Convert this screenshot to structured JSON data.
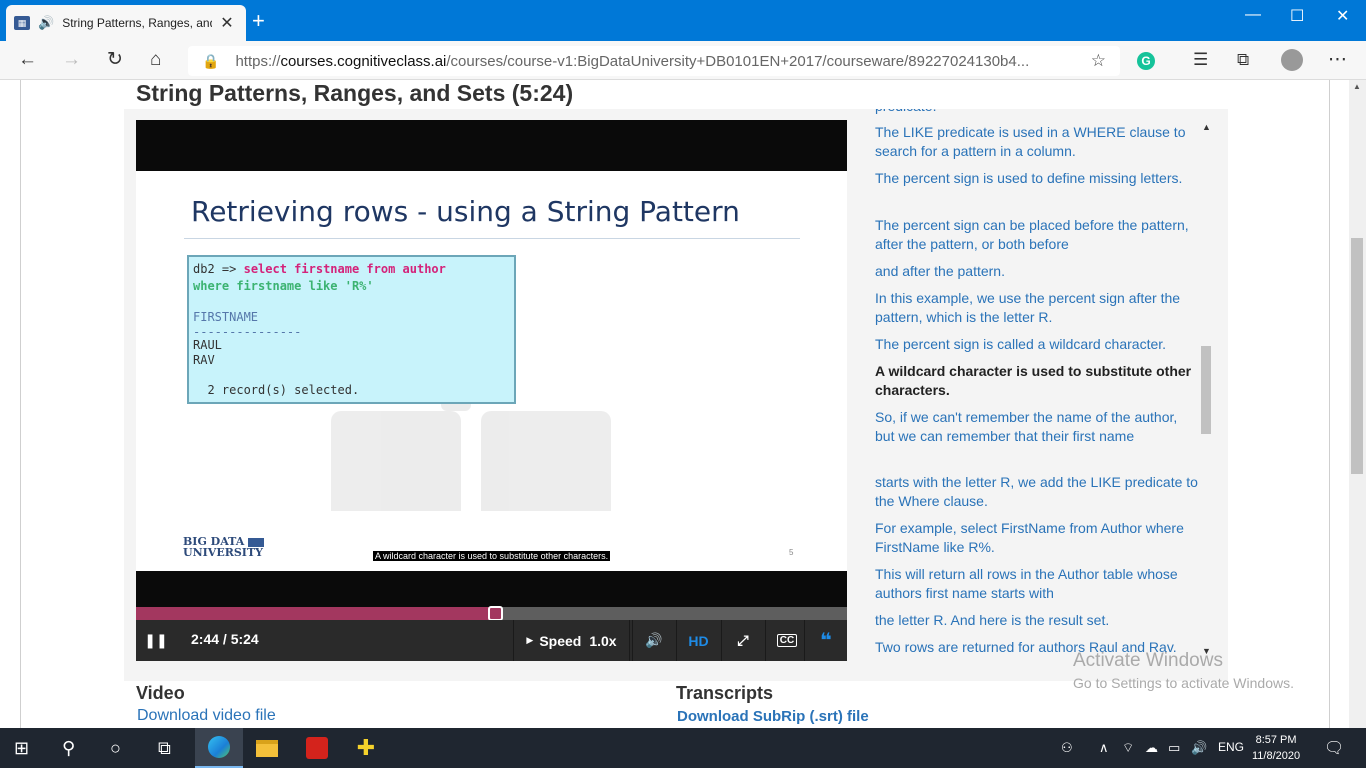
{
  "browser": {
    "tab_title": "String Patterns, Ranges, and Sets",
    "tab_close": "✕",
    "new_tab": "+",
    "url_prefix": "https://",
    "url_host": "courses.cognitiveclass.ai",
    "url_path": "/courses/course-v1:BigDataUniversity+DB0101EN+2017/courseware/89227024130b4...",
    "window_controls": {
      "minimize": "—",
      "maximize": "☐",
      "close": "✕"
    }
  },
  "page": {
    "video_heading": "String Patterns, Ranges, and Sets (5:24)"
  },
  "slide": {
    "title": "Retrieving rows - using a String Pattern",
    "code": {
      "prompt": "db2 =>",
      "line1_kw": "select firstname from author",
      "line2_kw": "where firstname like 'R%'",
      "column": "FIRSTNAME",
      "separator": "---------------",
      "rows": [
        "RAUL",
        "RAV"
      ],
      "summary": "2 record(s) selected."
    },
    "logo_line1": "BIG DATA",
    "logo_line2": "UNIVERSITY",
    "caption": "A wildcard character is used to substitute other characters.",
    "page_number": "5"
  },
  "player": {
    "current_time": "2:44",
    "duration": "5:24",
    "time_display": "2:44 / 5:24",
    "progress_fraction": 0.506,
    "speed_label": "Speed",
    "speed_value": "1.0x",
    "hd_label": "HD",
    "cc_label": "CC"
  },
  "transcript": {
    "lines": [
      {
        "text": "predicate.",
        "active": false
      },
      {
        "text": "The LIKE predicate is used in a WHERE clause to search for a pattern in a column.",
        "active": false
      },
      {
        "text": "The percent sign is used to define missing letters.",
        "active": false
      },
      {
        "text": "The percent sign can be placed before the pattern, after the pattern, or both before",
        "active": false
      },
      {
        "text": "and after the pattern.",
        "active": false
      },
      {
        "text": "In this example, we use the percent sign after the pattern, which is the letter R.",
        "active": false
      },
      {
        "text": "The percent sign is called a wildcard character.",
        "active": false
      },
      {
        "text": "A wildcard character is used to substitute other characters.",
        "active": true
      },
      {
        "text": "So, if we can't remember the name of the author, but we can remember that their first name",
        "active": false
      },
      {
        "text": "starts with the letter R, we add the LIKE predicate to the Where clause.",
        "active": false
      },
      {
        "text": "For example, select FirstName from Author where FirstName like R%.",
        "active": false
      },
      {
        "text": "This will return all rows in the Author table whose authors first name starts with",
        "active": false
      },
      {
        "text": "the letter R. And here is the result set.",
        "active": false
      },
      {
        "text": "Two rows are returned for authors Raul and Rav.",
        "active": false
      }
    ]
  },
  "downloads": {
    "video_title": "Video",
    "video_link": "Download video file",
    "transcripts_title": "Transcripts",
    "transcripts_link": "Download SubRip (.srt) file"
  },
  "watermark": {
    "line1": "Activate Windows",
    "line2": "Go to Settings to activate Windows."
  },
  "taskbar": {
    "language": "ENG",
    "time": "8:57 PM",
    "date": "11/8/2020"
  }
}
